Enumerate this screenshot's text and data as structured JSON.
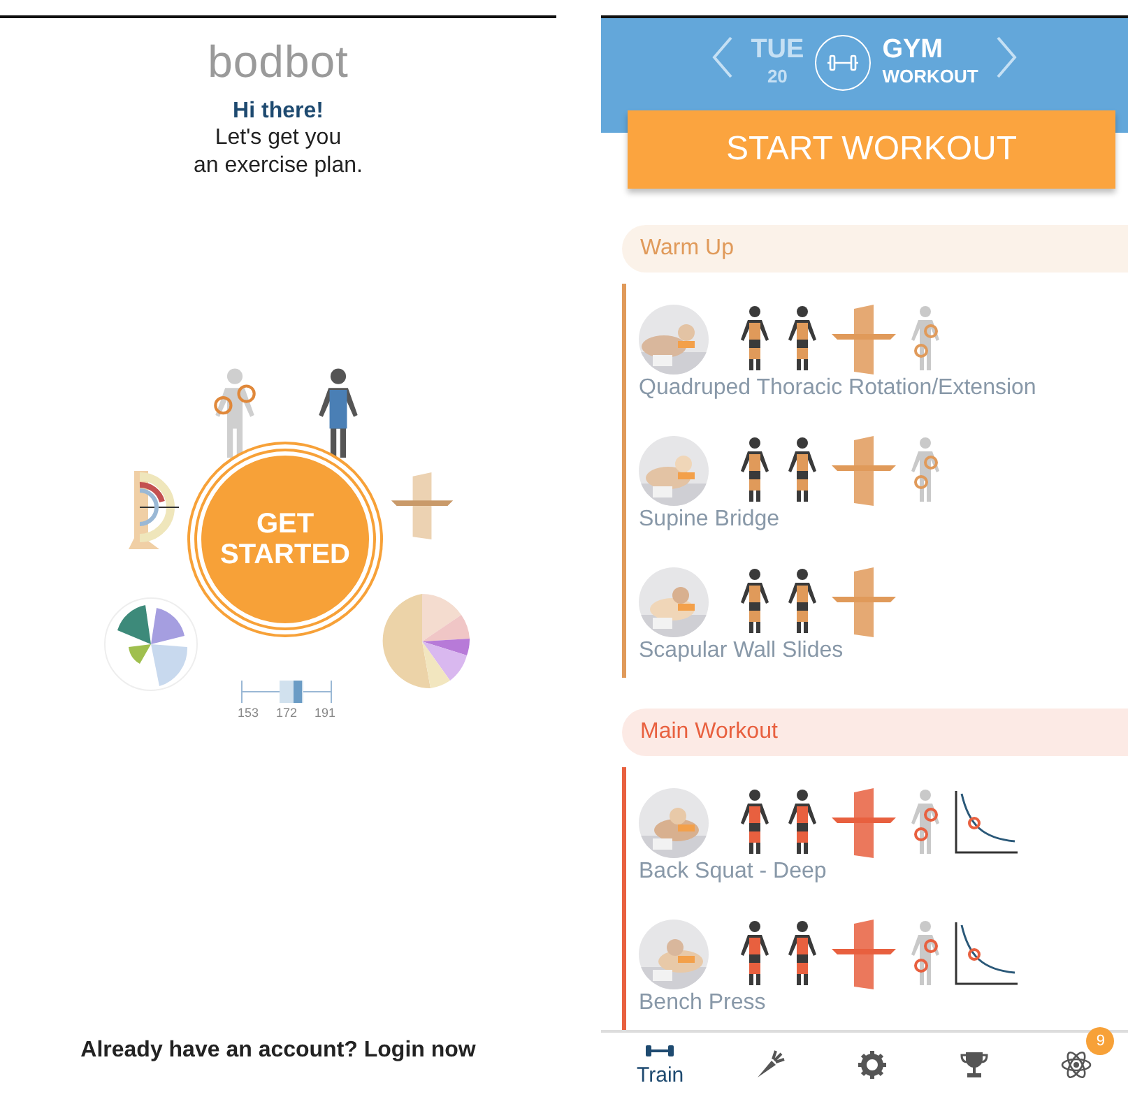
{
  "intro": {
    "logo": "bodbot",
    "greeting": "Hi there!",
    "message_lines": [
      "Let's get you",
      "an exercise plan."
    ],
    "start_button": "GET STARTED",
    "boxplot_ticks": [
      "153",
      "172",
      "191"
    ],
    "login_prompt": "Already have an account? Login now"
  },
  "header": {
    "day": "TUE",
    "date": "20",
    "workout_title": "GYM",
    "workout_subtitle": "WORKOUT"
  },
  "start_button": "START WORKOUT",
  "sections": [
    {
      "title": "Warm Up",
      "color": "#e09a5a",
      "exercises": [
        {
          "name": "Quadruped Thoracic Rotation/Extension",
          "diagrams": [
            {
              "kind": "muscles"
            },
            {
              "kind": "muscles"
            },
            {
              "kind": "plane"
            },
            {
              "kind": "joints"
            }
          ]
        },
        {
          "name": "Supine Bridge",
          "diagrams": [
            {
              "kind": "muscles"
            },
            {
              "kind": "muscles"
            },
            {
              "kind": "plane"
            },
            {
              "kind": "joints"
            }
          ]
        },
        {
          "name": "Scapular Wall Slides",
          "diagrams": [
            {
              "kind": "muscles"
            },
            {
              "kind": "muscles"
            },
            {
              "kind": "plane"
            }
          ]
        }
      ]
    },
    {
      "title": "Main Workout",
      "color": "#e8603f",
      "exercises": [
        {
          "name": "Back Squat - Deep",
          "diagrams": [
            {
              "kind": "muscles"
            },
            {
              "kind": "muscles"
            },
            {
              "kind": "plane"
            },
            {
              "kind": "joints"
            },
            {
              "kind": "curve"
            }
          ]
        },
        {
          "name": "Bench Press",
          "diagrams": [
            {
              "kind": "muscles"
            },
            {
              "kind": "muscles"
            },
            {
              "kind": "plane"
            },
            {
              "kind": "joints"
            },
            {
              "kind": "curve"
            }
          ]
        }
      ]
    }
  ],
  "tabs": [
    {
      "kind": "dumbbell",
      "label": "Train",
      "selected": true
    },
    {
      "kind": "carrot",
      "selected": false
    },
    {
      "kind": "gear",
      "selected": false
    },
    {
      "kind": "trophy",
      "selected": false
    },
    {
      "kind": "atom",
      "selected": false,
      "badge": "9"
    }
  ]
}
